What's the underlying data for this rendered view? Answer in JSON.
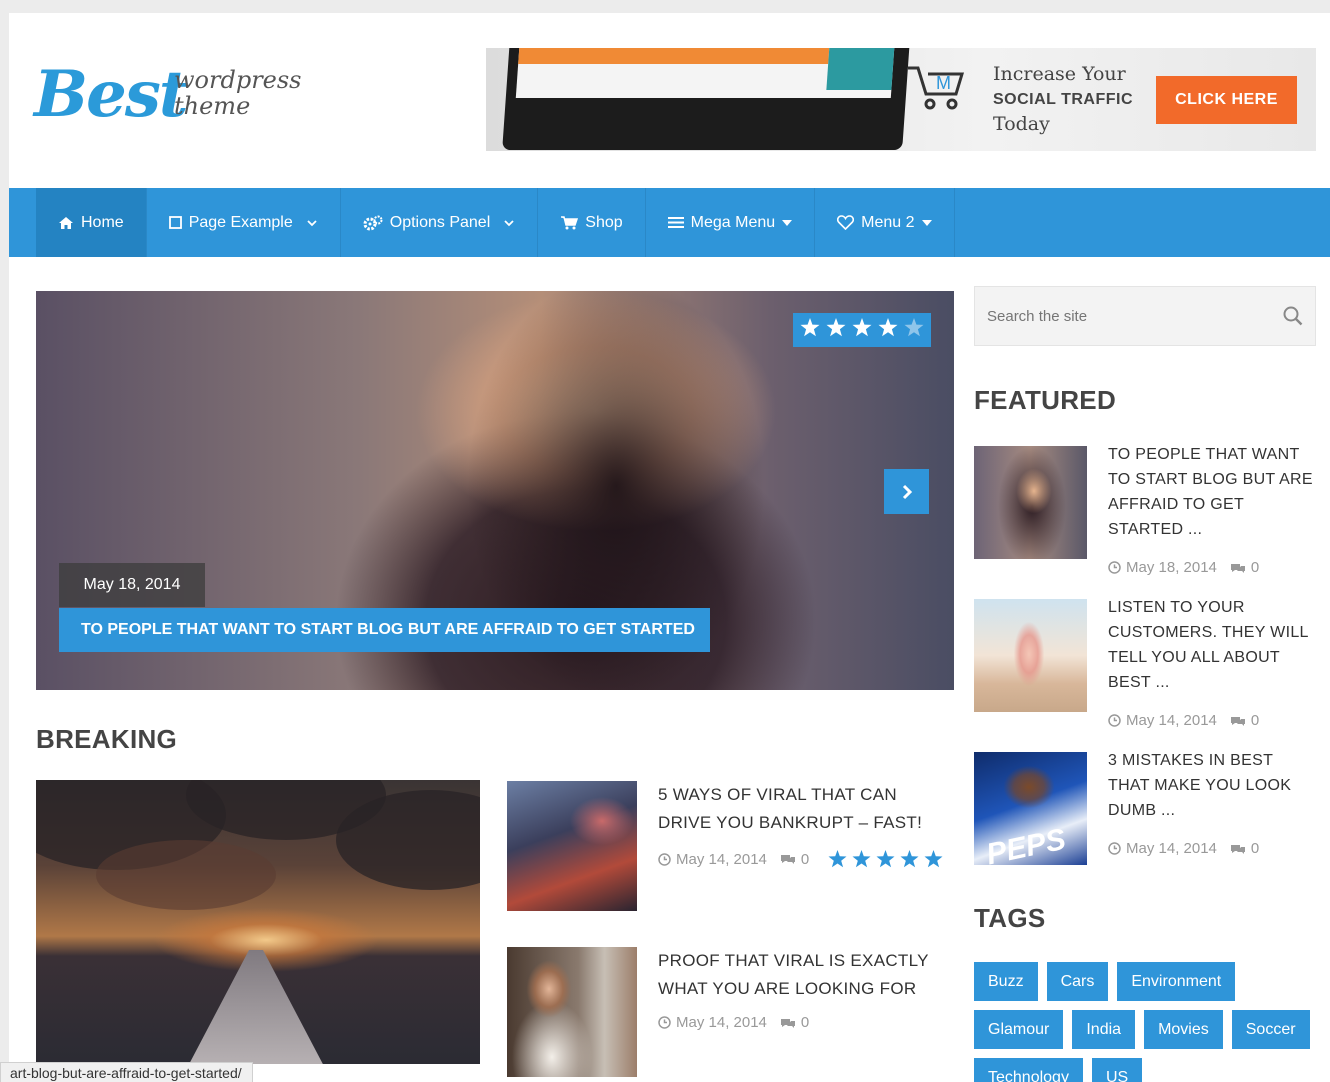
{
  "logo": {
    "main": "Best",
    "sub_line1": "wordpress",
    "sub_line2": "theme"
  },
  "banner": {
    "line1": "Increase Your",
    "line2": "SOCIAL TRAFFIC",
    "line3": "Today",
    "button": "CLICK HERE",
    "accent": "#f26a2a"
  },
  "nav": {
    "items": [
      {
        "label": "Home",
        "icon": "home-icon"
      },
      {
        "label": "Page Example",
        "icon": "square-icon",
        "dropdown": true
      },
      {
        "label": "Options Panel",
        "icon": "gears-icon",
        "dropdown": true
      },
      {
        "label": "Shop",
        "icon": "cart-icon"
      },
      {
        "label": "Mega Menu",
        "icon": "list-icon",
        "dropdown": true
      },
      {
        "label": "Menu 2",
        "icon": "heart-icon",
        "dropdown": true
      }
    ],
    "color": "#2f95d9"
  },
  "slider": {
    "date": "May 18, 2014",
    "title": "TO PEOPLE THAT WANT TO START BLOG BUT ARE AFFRAID TO GET STARTED",
    "rating": 4,
    "rating_max": 5
  },
  "breaking": {
    "heading": "BREAKING",
    "posts": [
      {
        "title": "5 WAYS OF VIRAL THAT CAN DRIVE YOU BANKRUPT – FAST!",
        "date": "May 14, 2014",
        "comments": "0",
        "rating": 5
      },
      {
        "title": "PROOF THAT VIRAL IS EXACTLY WHAT YOU ARE LOOKING FOR",
        "date": "May 14, 2014",
        "comments": "0"
      }
    ]
  },
  "search": {
    "placeholder": "Search the site"
  },
  "featured": {
    "heading": "FEATURED",
    "posts": [
      {
        "title": "TO PEOPLE THAT WANT TO START BLOG BUT ARE AFFRAID TO GET STARTED ...",
        "date": "May 18, 2014",
        "comments": "0"
      },
      {
        "title": "LISTEN TO YOUR CUSTOMERS. THEY WILL TELL YOU ALL ABOUT BEST ...",
        "date": "May 14, 2014",
        "comments": "0"
      },
      {
        "title": "3 MISTAKES IN BEST THAT MAKE YOU LOOK DUMB ...",
        "date": "May 14, 2014",
        "comments": "0"
      }
    ]
  },
  "tags": {
    "heading": "TAGS",
    "items": [
      "Buzz",
      "Cars",
      "Environment",
      "Glamour",
      "India",
      "Movies",
      "Soccer",
      "Technology",
      "US"
    ]
  },
  "status_url": "art-blog-but-are-affraid-to-get-started/"
}
